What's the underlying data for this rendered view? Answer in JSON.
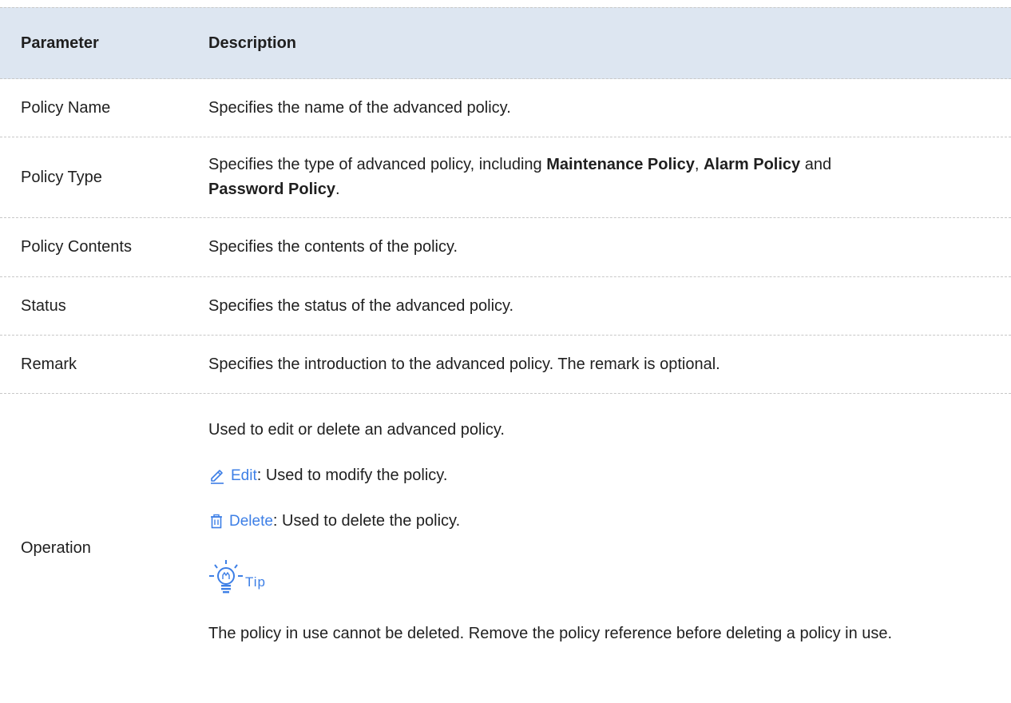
{
  "header": {
    "parameter": "Parameter",
    "description": "Description"
  },
  "rows": [
    {
      "param": "Policy Name",
      "desc": "Specifies the name of the advanced policy."
    },
    {
      "param": "Policy Type",
      "desc_prefix": "Specifies the type of advanced policy, including ",
      "bold1": "Maintenance Policy",
      "sep1": ", ",
      "bold2": "Alarm Policy",
      "sep2": " and",
      "bold3": "Password Policy",
      "end": "."
    },
    {
      "param": "Policy Contents",
      "desc": "Specifies the contents of the policy."
    },
    {
      "param": "Status",
      "desc": "Specifies the status of the advanced policy."
    },
    {
      "param": "Remark",
      "desc": "Specifies the introduction to the advanced policy. The remark is optional."
    },
    {
      "param": "Operation",
      "desc": "Used to edit or delete an advanced policy.",
      "edit_label": "Edit",
      "edit_desc": ": Used to modify the policy.",
      "delete_label": "Delete",
      "delete_desc": ": Used to delete the policy.",
      "tip_label": "Tip",
      "tip_text": "The policy in use cannot be deleted. Remove the policy reference before deleting a policy in use."
    }
  ],
  "icons": {
    "edit": "pencil-icon",
    "delete": "trash-icon",
    "tip": "lightbulb-icon"
  },
  "colors": {
    "header_bg": "#dde6f1",
    "accent": "#3d7fe6"
  }
}
